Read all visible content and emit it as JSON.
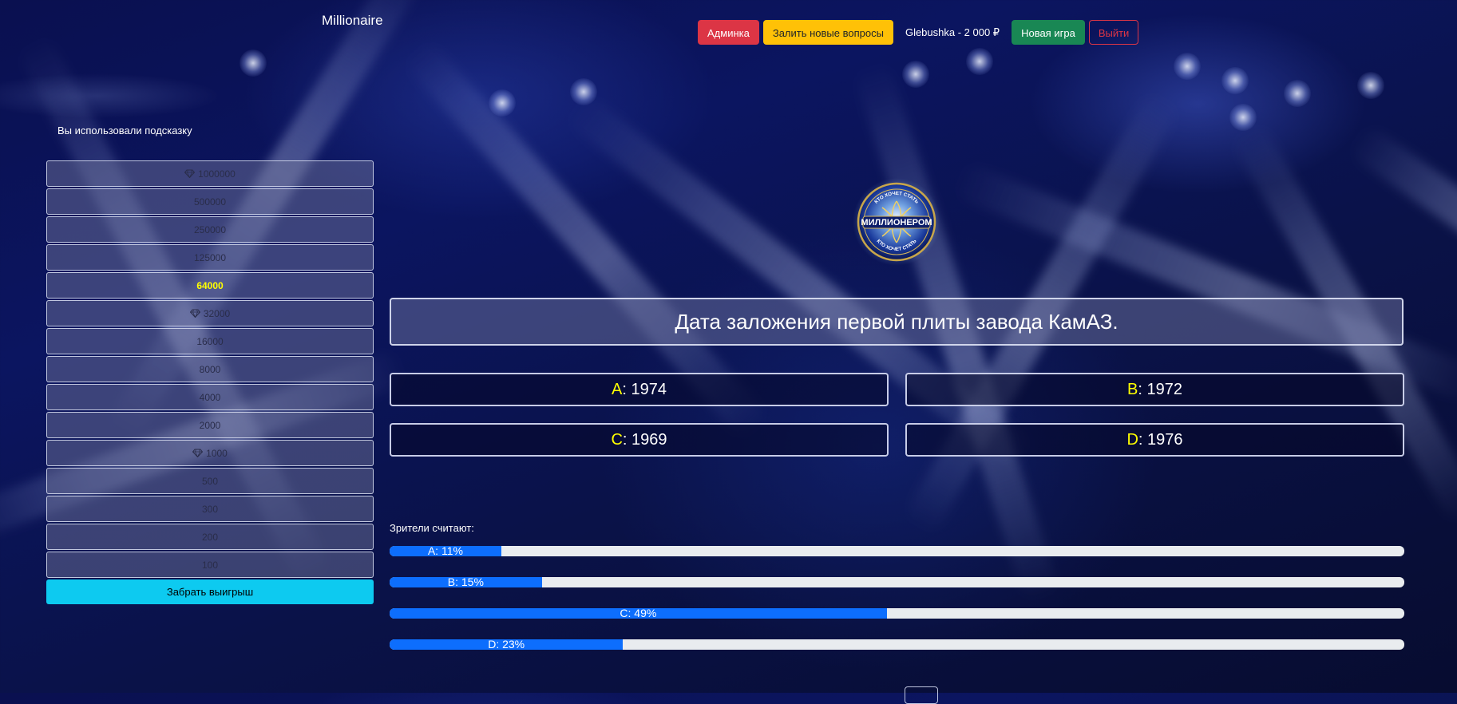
{
  "app": {
    "brand": "Millionaire"
  },
  "nav": {
    "admin_label": "Админка",
    "upload_label": "Залить новые вопросы",
    "user_balance": "Glebushka - 2 000 ₽",
    "new_game_label": "Новая игра",
    "logout_label": "Выйти"
  },
  "sidebar": {
    "hint_note": "Вы использовали подсказку",
    "prize_ladder": [
      {
        "amount": "1000000",
        "safe": true,
        "current": false
      },
      {
        "amount": "500000",
        "safe": false,
        "current": false
      },
      {
        "amount": "250000",
        "safe": false,
        "current": false
      },
      {
        "amount": "125000",
        "safe": false,
        "current": false
      },
      {
        "amount": "64000",
        "safe": false,
        "current": true
      },
      {
        "amount": "32000",
        "safe": true,
        "current": false
      },
      {
        "amount": "16000",
        "safe": false,
        "current": false
      },
      {
        "amount": "8000",
        "safe": false,
        "current": false
      },
      {
        "amount": "4000",
        "safe": false,
        "current": false
      },
      {
        "amount": "2000",
        "safe": false,
        "current": false
      },
      {
        "amount": "1000",
        "safe": true,
        "current": false
      },
      {
        "amount": "500",
        "safe": false,
        "current": false
      },
      {
        "amount": "300",
        "safe": false,
        "current": false
      },
      {
        "amount": "200",
        "safe": false,
        "current": false
      },
      {
        "amount": "100",
        "safe": false,
        "current": false
      }
    ],
    "take_winnings_label": "Забрать выигрыш"
  },
  "logo": {
    "top_text": "КТО ХОЧЕТ СТАТЬ",
    "main_text": "МИЛЛИОНЕРОМ",
    "bottom_text": "КТО ХОЧЕТ СТАТЬ"
  },
  "question": {
    "text": "Дата заложения первой плиты завода КамАЗ.",
    "answers": [
      {
        "letter": "A",
        "sep": ":",
        "text": " 1974"
      },
      {
        "letter": "B",
        "sep": ":",
        "text": " 1972"
      },
      {
        "letter": "C",
        "sep": ":",
        "text": " 1969"
      },
      {
        "letter": "D",
        "sep": ":",
        "text": " 1976"
      }
    ]
  },
  "audience": {
    "title": "Зрители считают:",
    "results": [
      {
        "label": "A: 11%",
        "percent": 11
      },
      {
        "label": "B: 15%",
        "percent": 15
      },
      {
        "label": "C: 49%",
        "percent": 49
      },
      {
        "label": "D: 23%",
        "percent": 23
      }
    ]
  },
  "colors": {
    "accent_letter": "#ffff00",
    "admin": "#dc3545",
    "upload": "#ffc107",
    "new_game": "#198754",
    "take_winnings": "#0dcaf0",
    "poll_bar": "#0d6efd"
  }
}
